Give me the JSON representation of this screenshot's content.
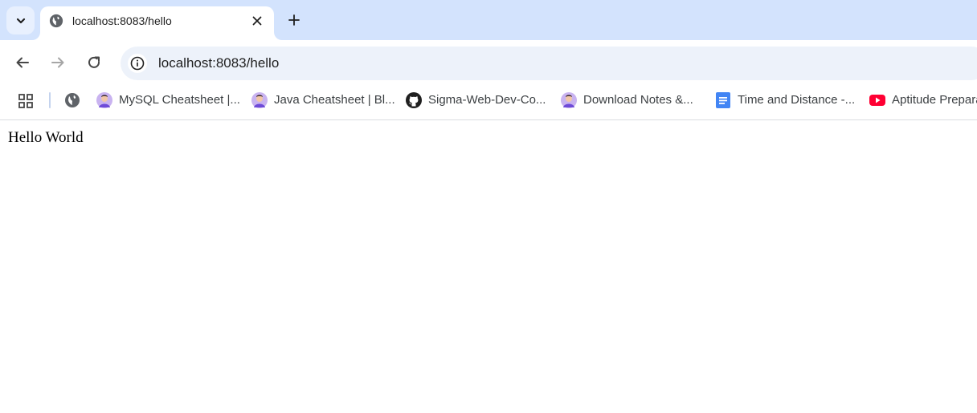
{
  "browser": {
    "tab": {
      "title": "localhost:8083/hello",
      "favicon": "globe-icon"
    },
    "toolbar": {
      "url": "localhost:8083/hello"
    },
    "bookmarks": [
      {
        "label": "MySQL Cheatsheet |...",
        "icon": "avatar-icon"
      },
      {
        "label": "Java Cheatsheet | Bl...",
        "icon": "avatar-icon"
      },
      {
        "label": "Sigma-Web-Dev-Co...",
        "icon": "github-icon"
      },
      {
        "label": "Download Notes &...",
        "icon": "avatar-icon"
      },
      {
        "label": "Time and Distance -...",
        "icon": "google-docs-icon"
      },
      {
        "label": "Aptitude Prepara",
        "icon": "youtube-icon"
      }
    ],
    "colors": {
      "tabstrip": "#d3e3fd",
      "omnibox": "#edf2fa",
      "youtube": "#ff0033",
      "docs": "#4285f4"
    }
  },
  "page": {
    "text": "Hello World"
  }
}
